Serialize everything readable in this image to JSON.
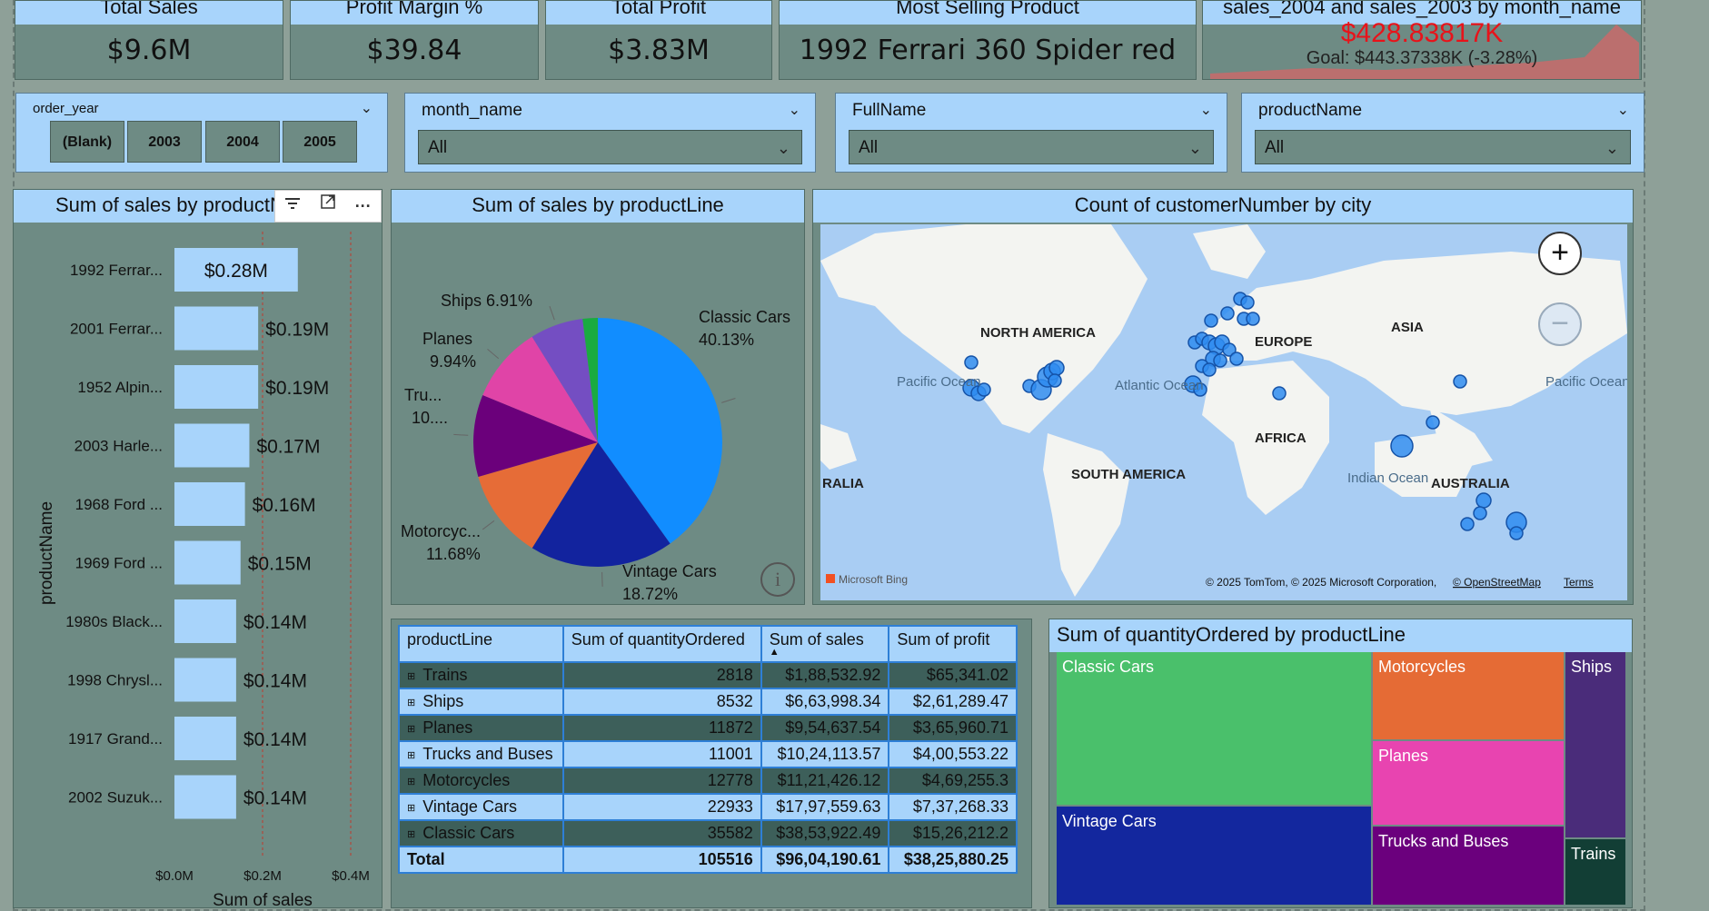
{
  "kpis": [
    {
      "title": "Total Sales",
      "value": "$9.6M"
    },
    {
      "title": "Profit Margin %",
      "value": "$39.84"
    },
    {
      "title": "Total Profit",
      "value": "$3.83M"
    },
    {
      "title": "Most Selling Product",
      "value": "1992 Ferrari 360 Spider red"
    }
  ],
  "gauge_card": {
    "title": "sales_2004 and sales_2003 by month_name",
    "value": "$428.83817K",
    "goal": "Goal: $443.37338K (-3.28%)",
    "value_color": "#e8131a",
    "area_color": "#c96a6a"
  },
  "slicers": {
    "order_year": {
      "label": "order_year",
      "buttons": [
        "(Blank)",
        "2003",
        "2004",
        "2005"
      ]
    },
    "month_name": {
      "label": "month_name",
      "selected": "All"
    },
    "fullname": {
      "label": "FullName",
      "selected": "All"
    },
    "productname": {
      "label": "productName",
      "selected": "All"
    }
  },
  "bar_chart": {
    "title": "Sum of sales by productName",
    "ylabel": "productName",
    "xlabel": "Sum of sales",
    "toolbar": [
      "filter-icon",
      "focus-mode-icon",
      "more-options-icon"
    ]
  },
  "pie_chart": {
    "title": "Sum of sales by productLine",
    "info_icon": "info-icon"
  },
  "map": {
    "title": "Count of customerNumber by city",
    "attribution": "© 2025 TomTom, © 2025 Microsoft Corporation,",
    "osm": "© OpenStreetMap",
    "terms": "Terms",
    "brand": "Microsoft Bing",
    "labels": {
      "north_america": "NORTH AMERICA",
      "europe": "EUROPE",
      "asia": "ASIA",
      "africa": "AFRICA",
      "south_america": "SOUTH AMERICA",
      "australia": "AUSTRALIA",
      "ralia": "RALIA",
      "pacific_left": "Pacific Ocean",
      "atlantic": "Atlantic Ocean",
      "indian": "Indian Ocean",
      "pacific_right": "Pacific Ocean"
    }
  },
  "table": {
    "headers": [
      "productLine",
      "Sum of quantityOrdered",
      "Sum of sales",
      "Sum of profit"
    ],
    "rows": [
      [
        "Trains",
        "2818",
        "$1,88,532.92",
        "$65,341.02"
      ],
      [
        "Ships",
        "8532",
        "$6,63,998.34",
        "$2,61,289.47"
      ],
      [
        "Planes",
        "11872",
        "$9,54,637.54",
        "$3,65,960.71"
      ],
      [
        "Trucks and Buses",
        "11001",
        "$10,24,113.57",
        "$4,00,553.22"
      ],
      [
        "Motorcycles",
        "12778",
        "$11,21,426.12",
        "$4,69,255.3"
      ],
      [
        "Vintage Cars",
        "22933",
        "$17,97,559.63",
        "$7,37,268.33"
      ],
      [
        "Classic Cars",
        "35582",
        "$38,53,922.49",
        "$15,26,212.2"
      ]
    ],
    "total": [
      "Total",
      "105516",
      "$96,04,190.61",
      "$38,25,880.25"
    ]
  },
  "treemap": {
    "title": "Sum of quantityOrdered by productLine",
    "labels": [
      "Classic Cars",
      "Vintage Cars",
      "Motorcycles",
      "Planes",
      "Trucks and Buses",
      "Ships",
      "Trains"
    ],
    "colors": {
      "Classic Cars": "#4ac06b",
      "Vintage Cars": "#13279e",
      "Motorcycles": "#e56b35",
      "Planes": "#e844b0",
      "Trucks and Buses": "#6b007d",
      "Ships": "#4a2c7a",
      "Trains": "#123e35"
    }
  },
  "chart_data": [
    {
      "type": "bar",
      "title": "Sum of sales by productName",
      "xlabel": "Sum of sales",
      "ylabel": "productName",
      "categories": [
        "1992 Ferrar...",
        "2001 Ferrar...",
        "1952 Alpin...",
        "2003 Harle...",
        "1968 Ford ...",
        "1969 Ford ...",
        "1980s Black...",
        "1998 Chrysl...",
        "1917 Grand...",
        "2002 Suzuk..."
      ],
      "values": [
        0.28,
        0.19,
        0.19,
        0.17,
        0.16,
        0.15,
        0.14,
        0.14,
        0.14,
        0.14
      ],
      "value_labels": [
        "$0.28M",
        "$0.19M",
        "$0.19M",
        "$0.17M",
        "$0.16M",
        "$0.15M",
        "$0.14M",
        "$0.14M",
        "$0.14M",
        "$0.14M"
      ],
      "xticks": [
        "$0.0M",
        "$0.2M",
        "$0.4M"
      ],
      "xlim": [
        0,
        0.4
      ],
      "grid": true,
      "color": "#a8d4fb"
    },
    {
      "type": "pie",
      "title": "Sum of sales by productLine",
      "slices": [
        {
          "name": "Classic Cars",
          "pct": 40.13,
          "label": "40.13%",
          "color": "#118dff"
        },
        {
          "name": "Vintage Cars",
          "pct": 18.72,
          "label": "18.72%",
          "color": "#12239e"
        },
        {
          "name": "Motorcycles",
          "pct": 11.68,
          "label": "11.68%",
          "display": "Motorcyc...",
          "color": "#e66c37"
        },
        {
          "name": "Trucks and Buses",
          "pct": 10.66,
          "label": "10....",
          "display": "Tru...",
          "color": "#6b007b"
        },
        {
          "name": "Planes",
          "pct": 9.94,
          "label": "9.94%",
          "display": "Planes",
          "color": "#e044a7"
        },
        {
          "name": "Ships",
          "pct": 6.91,
          "label": "6.91%",
          "display": "Ships",
          "color": "#744ec2"
        },
        {
          "name": "Trains",
          "pct": 1.96,
          "label": "",
          "color": "#1aab40"
        }
      ]
    },
    {
      "type": "treemap",
      "title": "Sum of quantityOrdered by productLine",
      "categories": [
        "Classic Cars",
        "Vintage Cars",
        "Motorcycles",
        "Planes",
        "Trucks and Buses",
        "Ships",
        "Trains"
      ],
      "values": [
        35582,
        22933,
        12778,
        11872,
        11001,
        8532,
        2818
      ]
    }
  ]
}
